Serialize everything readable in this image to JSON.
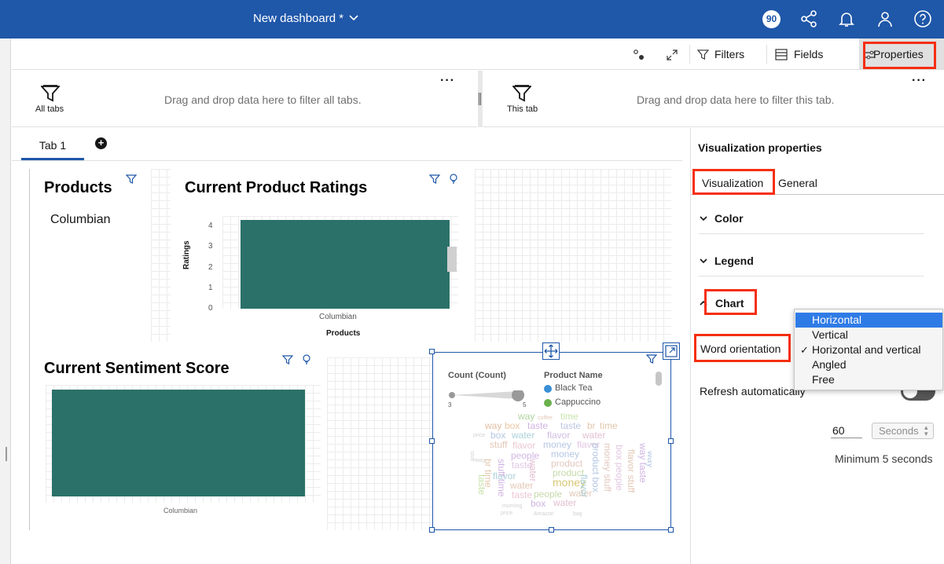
{
  "header": {
    "title": "New dashboard *",
    "notifications_count": "90"
  },
  "toolbar": {
    "filters_label": "Filters",
    "fields_label": "Fields",
    "properties_label": "Properties"
  },
  "filters": {
    "all_tabs_label": "All tabs",
    "all_tabs_hint": "Drag and drop data here to filter all tabs.",
    "this_tab_label": "This tab",
    "this_tab_hint": "Drag and drop data here to filter this tab."
  },
  "tabs": [
    {
      "label": "Tab 1"
    }
  ],
  "widgets": {
    "products": {
      "title": "Products",
      "value": "Columbian"
    },
    "ratings": {
      "title": "Current Product Ratings",
      "ylabel": "Ratings",
      "xlabel": "Products",
      "category": "Columbian"
    },
    "sentiment": {
      "title": "Current Sentiment Score",
      "category": "Columbian"
    },
    "wordcloud": {
      "legend_size_title": "Count (Count)",
      "legend_size_min": "3",
      "legend_size_max": "5",
      "legend_color_title": "Product Name",
      "legend_items": [
        {
          "label": "Black Tea",
          "color": "#3a8fd6"
        },
        {
          "label": "Cappuccino",
          "color": "#6ab04c"
        }
      ]
    }
  },
  "chart_data": [
    {
      "type": "bar",
      "title": "Current Product Ratings",
      "categories": [
        "Columbian"
      ],
      "values": [
        4.3
      ],
      "xlabel": "Products",
      "ylabel": "Ratings",
      "yticks": [
        "0",
        "1",
        "2",
        "3",
        "4"
      ],
      "ylim": [
        0,
        4.5
      ],
      "color": "#2b7169"
    },
    {
      "type": "bar",
      "title": "Current Sentiment Score",
      "categories": [
        "Columbian"
      ],
      "values": [
        1
      ],
      "color": "#2b7169"
    }
  ],
  "properties": {
    "title": "Visualization properties",
    "tabs": [
      "Visualization",
      "General"
    ],
    "sections": [
      "Color",
      "Legend",
      "Chart"
    ],
    "word_orientation_label": "Word orientation",
    "refresh_label": "Refresh automatically",
    "refresh_value": "60",
    "refresh_unit": "Seconds",
    "refresh_min_note": "Minimum 5 seconds"
  },
  "dropdown": {
    "options": [
      "Horizontal",
      "Vertical",
      "Horizontal and vertical",
      "Angled",
      "Free"
    ],
    "highlighted": "Horizontal",
    "checked": "Horizontal and vertical",
    "highlight_color": "#2f7be6"
  },
  "colors": {
    "brand": "#1f57a9",
    "annotation_red": "#f52f12",
    "bar": "#2b7169"
  }
}
